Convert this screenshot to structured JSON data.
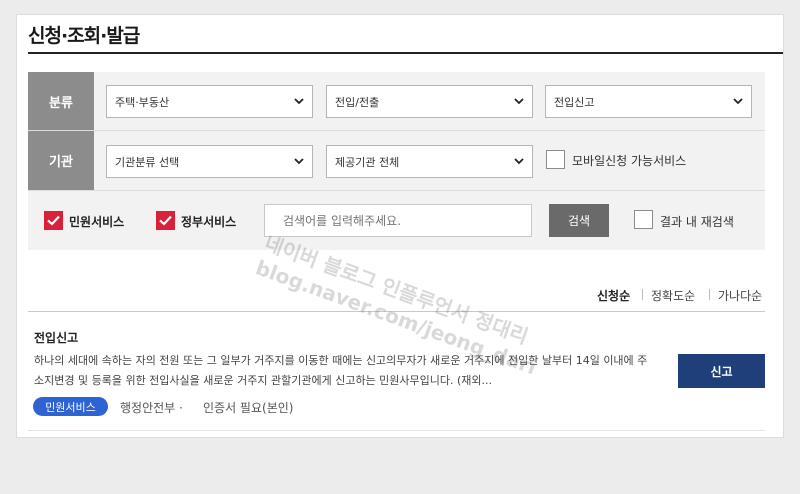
{
  "header": {
    "title": "신청·조회·발급"
  },
  "filters": {
    "category_label": "분류",
    "category_selects": [
      "주택·부동산",
      "전입/전출",
      "전입신고"
    ],
    "agency_label": "기관",
    "agency_selects": [
      "기관분류 선택",
      "제공기관 전체"
    ],
    "mobile_checkbox_label": "모바일신청 가능서비스",
    "civil_service_label": "민원서비스",
    "gov_service_label": "정부서비스",
    "search_placeholder": "검색어를 입력해주세요.",
    "search_button": "검색",
    "research_label": "결과 내 재검색"
  },
  "sort": {
    "options": [
      "신청순",
      "정확도순",
      "가나다순"
    ],
    "active": "신청순"
  },
  "result": {
    "title": "전입신고",
    "description": "하나의 세대에 속하는 자의 전원 또는 그 일부가 거주지를 이동한 때에는 신고의무자가 새로운 거주지에 전입한 날부터 14일 이내에 주소지변경 및 등록을 위한 전입사실을 새로운 거주지 관할기관에게 신고하는 민원사무입니다. (재외...",
    "badge": "민원서비스",
    "agency": "행정안전부 ·",
    "auth": "인증서 필요(본인)",
    "apply_button": "신고"
  },
  "watermark": {
    "line1": "네이버 블로그 인플루언서 정대리",
    "line2": "blog.naver.com/jeong_dari"
  },
  "colors": {
    "accent_red": "#d9213b",
    "navy": "#1e3f7a",
    "badge_blue": "#2d63d3",
    "label_gray": "#8c8c8c"
  }
}
